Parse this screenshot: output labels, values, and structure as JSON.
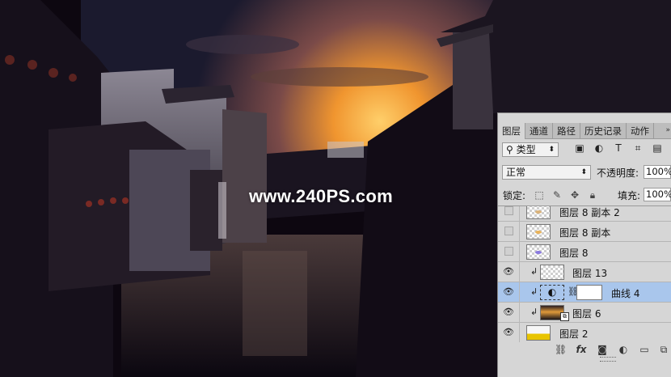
{
  "watermark": "www.240PS.com",
  "panel": {
    "tabs": [
      "图层",
      "通道",
      "路径",
      "历史记录",
      "动作"
    ],
    "filter_label": "类型",
    "blend_mode": "正常",
    "opacity_label": "不透明度:",
    "opacity_value": "100%",
    "lock_label": "锁定:",
    "fill_label": "填充:",
    "fill_value": "100%",
    "layers": [
      {
        "name": "图层 8 副本 2",
        "visible": false
      },
      {
        "name": "图层 8 副本",
        "visible": false
      },
      {
        "name": "图层 8",
        "visible": false
      },
      {
        "name": "图层 13",
        "visible": true
      },
      {
        "name": "曲线 4",
        "visible": true,
        "selected": true
      },
      {
        "name": "图层 6",
        "visible": true
      },
      {
        "name": "图层 2",
        "visible": true
      }
    ]
  },
  "icons": {
    "visibility": "eye-icon",
    "clip": "clipping-arrow-icon",
    "link": "chain-link-icon",
    "fx": "fx-icon",
    "mask": "mask-icon",
    "adjust": "adjustment-icon",
    "folder": "folder-icon",
    "new": "new-layer-icon",
    "trash": "trash-icon"
  },
  "colors": {
    "panel_bg": "#d6d6d6",
    "selected_row": "#a9c6ec",
    "sky_glow": "#f2a53c"
  }
}
